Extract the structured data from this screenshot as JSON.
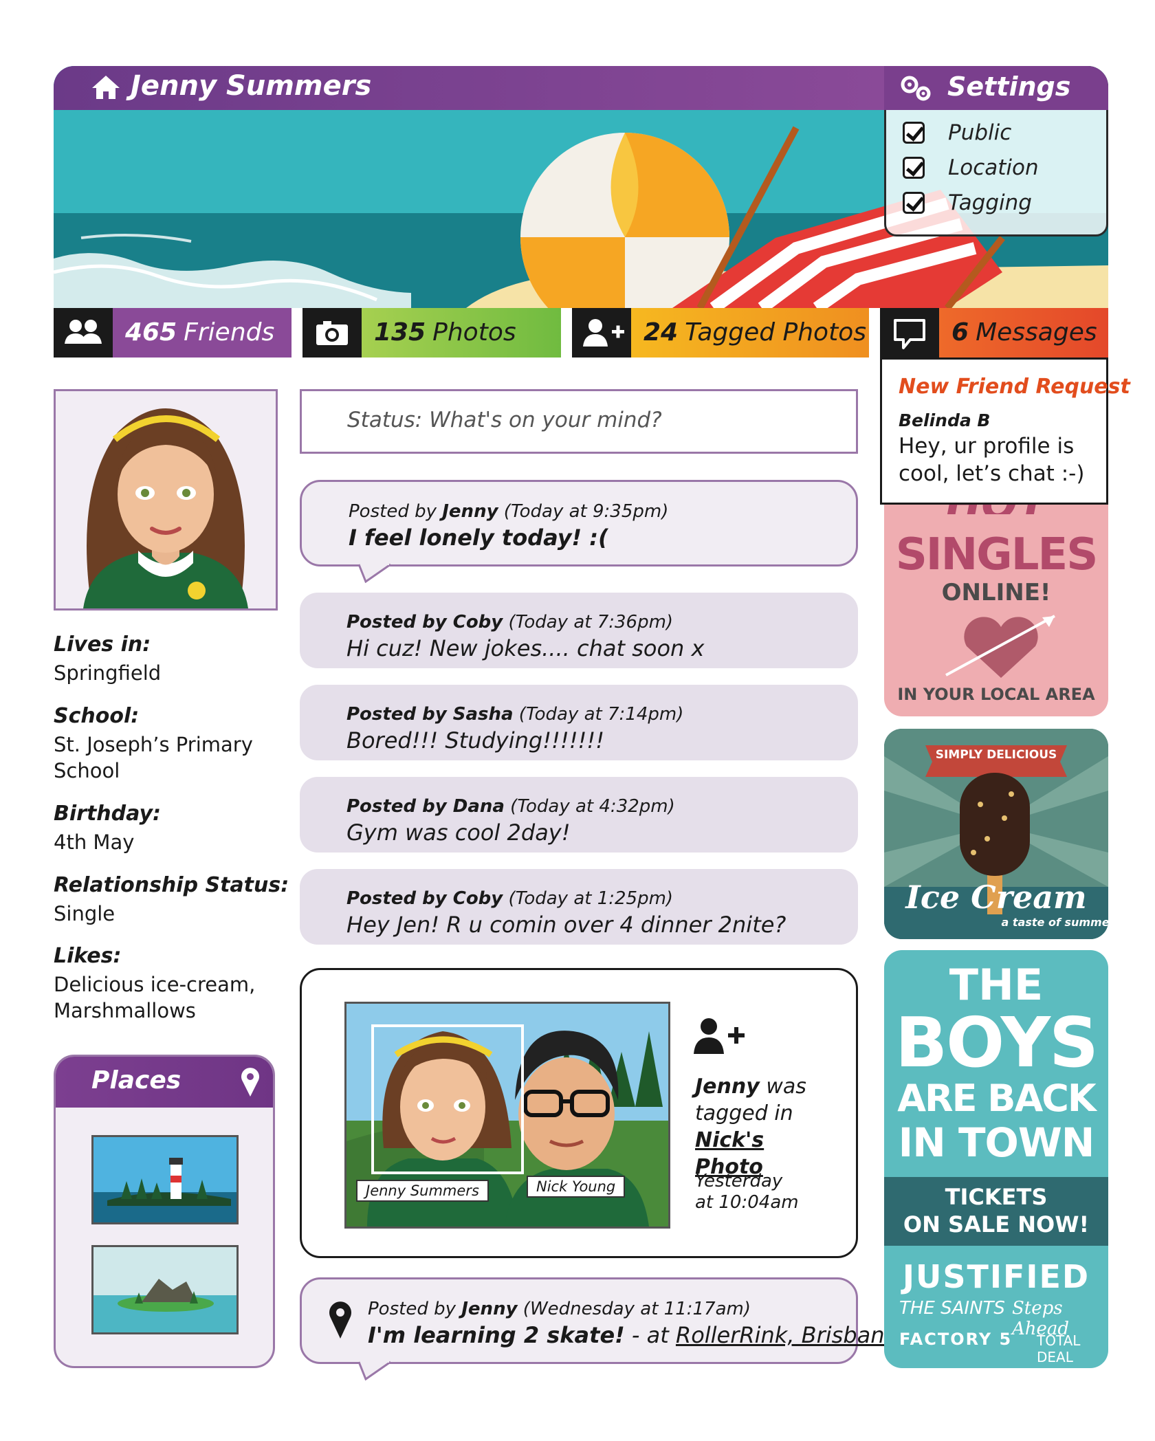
{
  "header": {
    "name": "Jenny Summers"
  },
  "settings": {
    "title": "Settings",
    "options": [
      {
        "label": "Public",
        "checked": true
      },
      {
        "label": "Location",
        "checked": true
      },
      {
        "label": "Tagging",
        "checked": true
      }
    ]
  },
  "stats": [
    {
      "count": "465",
      "label": "Friends",
      "icon": "friends-icon",
      "color": "#8a4a98"
    },
    {
      "count": "135",
      "label": "Photos",
      "icon": "camera-icon",
      "color": "#7cc243"
    },
    {
      "count": "24",
      "label": "Tagged Photos",
      "icon": "add-person-icon",
      "color": "#f0a020"
    },
    {
      "count": "6",
      "label": "Messages",
      "icon": "speech-bubble-icon",
      "color": "#e8562a"
    }
  ],
  "messages_dropdown": {
    "title": "New Friend Request",
    "sender": "Belinda B",
    "message": "Hey, ur profile is cool, let’s chat :-)"
  },
  "profile": {
    "lives_in_label": "Lives in:",
    "lives_in": "Springfield",
    "school_label": "School:",
    "school": "St. Joseph’s Primary School",
    "birthday_label": "Birthday:",
    "birthday": "4th May",
    "relationship_label": "Relationship Status:",
    "relationship": "Single",
    "likes_label": "Likes:",
    "likes": "Delicious ice-cream, Marshmallows"
  },
  "places": {
    "title": "Places"
  },
  "status_input": {
    "placeholder": "Status: What's on your mind?"
  },
  "posts": [
    {
      "prefix": "Posted by ",
      "author": "Jenny",
      "time": " (Today at 9:35pm)",
      "text": "I feel lonely today! :("
    },
    {
      "prefix": "Posted by ",
      "author": "Coby",
      "time": " (Today at 7:36pm)",
      "text": "Hi cuz! New jokes.... chat soon x"
    },
    {
      "prefix": "Posted by ",
      "author": "Sasha",
      "time": " (Today at 7:14pm)",
      "text": "Bored!!! Studying!!!!!!!"
    },
    {
      "prefix": "Posted by ",
      "author": "Dana",
      "time": " (Today at 4:32pm)",
      "text": "Gym was cool 2day!"
    },
    {
      "prefix": "Posted by ",
      "author": "Coby",
      "time": " (Today at 1:25pm)",
      "text": "Hey Jen! R u comin over 4 dinner 2nite?"
    }
  ],
  "tag_card": {
    "tag1": "Jenny Summers",
    "tag2": "Nick Young",
    "who": "Jenny",
    "was_tagged": " was tagged in ",
    "photo_link": "Nick's Photo",
    "time_line1": "Yesterday",
    "time_line2": "at 10:04am"
  },
  "checkin": {
    "prefix": "Posted by ",
    "author": "Jenny",
    "time": " (Wednesday at 11:17am)",
    "text": "I'm learning 2 skate!",
    "at": " - at ",
    "place": "RollerRink, Brisbane"
  },
  "ads": {
    "singles": {
      "line1": "HOT",
      "line2": "SINGLES",
      "line3": "ONLINE!",
      "line4": "IN YOUR LOCAL AREA"
    },
    "icecream": {
      "banner": "SIMPLY DELICIOUS",
      "title": "Ice Cream",
      "tagline": "a taste of summer"
    },
    "concert": {
      "l1": "THE",
      "l2": "BOYS",
      "l3": "ARE BACK",
      "l4": "IN TOWN",
      "tickets1": "TICKETS",
      "tickets2": "ON SALE NOW!",
      "band1": "JUSTIFIED",
      "band2": "THE SAINTS",
      "band3": "Steps Ahead",
      "band4": "FACTORY 5",
      "band5": "TOTAL DEAL"
    }
  }
}
